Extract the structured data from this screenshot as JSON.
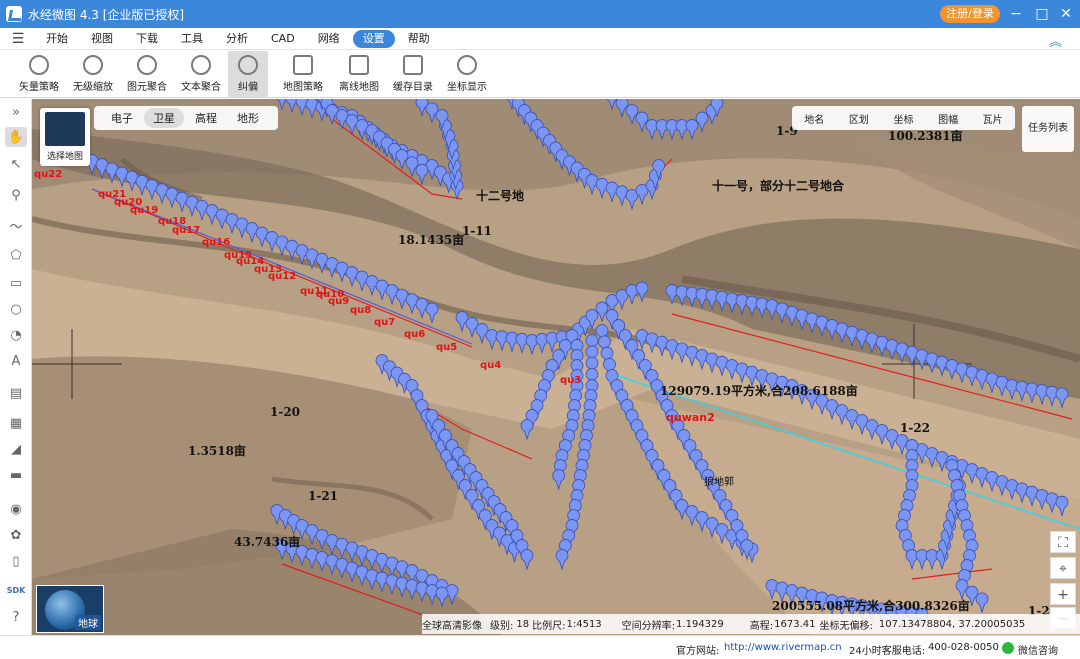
{
  "app": {
    "title": "水经微图 4.3 [企业版已授权]",
    "login": "注册/登录"
  },
  "menu": [
    "开始",
    "视图",
    "下载",
    "工具",
    "分析",
    "CAD",
    "网络",
    "设置",
    "帮助"
  ],
  "active_menu": "设置",
  "toolbar": [
    "矢量策略",
    "无级缩放",
    "图元聚合",
    "文本聚合",
    "纠偏",
    "地图策略",
    "离线地图",
    "缓存目录",
    "坐标显示"
  ],
  "active_tool": "纠偏",
  "map_switch": {
    "label": "选择地图"
  },
  "map_types": [
    "电子",
    "卫星",
    "高程",
    "地形"
  ],
  "active_map_type": "卫星",
  "layers": [
    "地名",
    "区划",
    "坐标",
    "图幅",
    "瓦片"
  ],
  "task_list": "任务列表",
  "globe_label": "地球",
  "map_labels": {
    "l1": "十二号地",
    "l2": "十一号，部分十二号地合",
    "l3": "18.1435亩",
    "l4": "1-11",
    "l5": "1-9",
    "l6": "100.2381亩",
    "l7": "129079.19平方米,合208.6188亩",
    "l8": "1-22",
    "l9": "1-20",
    "l10": "1.3518亩",
    "l11": "1-21",
    "l12": "43.7436亩",
    "l13": "狼地郭",
    "l14": "200555.08平方米,合300.8326亩",
    "l15": "1-2"
  },
  "qu_labels": {
    "q22": "qu22",
    "q21": "qu21",
    "q20": "qu20",
    "q19": "qu19",
    "q18": "qu18",
    "q17": "qu17",
    "q16": "qu16",
    "q15": "qu15",
    "q14": "qu14",
    "q13": "qu13",
    "q12": "qu12",
    "q11": "qu11",
    "q10": "qu10",
    "q9": "qu9",
    "q8": "qu8",
    "q7": "qu7",
    "q6": "qu6",
    "q5": "qu5",
    "q4": "qu4",
    "q3": "qu3",
    "qw": "quwan2"
  },
  "info": {
    "source": "全球高清影像",
    "level_label": "级别:",
    "level": "18",
    "scale_label": "比例尺:",
    "scale": "1:4513",
    "resolution_label": "空间分辨率:",
    "resolution": "1.194329",
    "elevation_label": "高程:",
    "elevation": "1673.41",
    "coord_label": "坐标无偏移:",
    "coord": "107.13478804, 37.20005035"
  },
  "status": {
    "site_label": "官方网站:",
    "site": "http://www.rivermap.cn",
    "phone_label": "24小时客服电话:",
    "phone": "400-028-0050",
    "wechat": "微信咨询"
  },
  "colors": {
    "accent": "#3a87dc",
    "login": "#f2932e",
    "pin": "#7a95f2",
    "label_red": "#e01414"
  }
}
